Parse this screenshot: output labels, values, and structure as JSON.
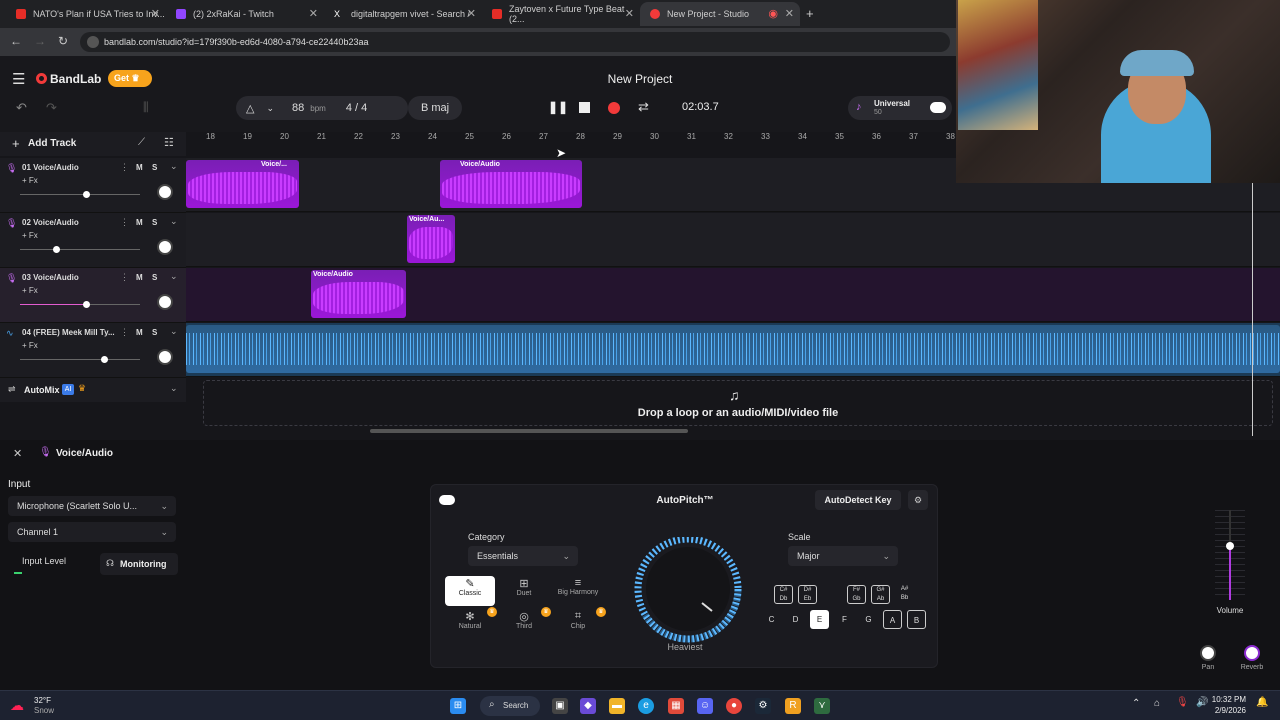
{
  "browser": {
    "tabs": [
      {
        "title": "NATO's Plan if USA Tries to Inv...",
        "color": "#e52d27"
      },
      {
        "title": "(2) 2xRaKai - Twitch",
        "color": "#9146ff"
      },
      {
        "title": "digitaltrapgem vivet - Search /",
        "color": "#ffffff"
      },
      {
        "title": "Zaytoven x Future Type Beat (2...",
        "color": "#e52d27"
      },
      {
        "title": "New Project - Studio",
        "color": "#f23a3a"
      }
    ],
    "url": "bandlab.com/studio?id=179f390b-ed6d-4080-a794-ce22440b23aa"
  },
  "app": {
    "logo": "BandLab",
    "get_label": "Get",
    "project_title": "New Project",
    "bpm": "88",
    "bpm_unit": "bpm",
    "time_signature": "4 / 4",
    "key": "B maj",
    "time": "02:03.7",
    "instrument_name": "Universal",
    "instrument_sub": "50",
    "add_track": "Add Track"
  },
  "ruler": [
    "18",
    "19",
    "20",
    "21",
    "22",
    "23",
    "24",
    "25",
    "26",
    "27",
    "28",
    "29",
    "30",
    "31",
    "32",
    "33",
    "34",
    "35",
    "36",
    "37",
    "38"
  ],
  "tracks": [
    {
      "name": "01 Voice/Audio",
      "fx": "+ Fx",
      "mute": "M",
      "solo": "S",
      "volume": 0.55
    },
    {
      "name": "02 Voice/Audio",
      "fx": "+ Fx",
      "mute": "M",
      "solo": "S",
      "volume": 0.3
    },
    {
      "name": "03 Voice/Audio",
      "fx": "+ Fx",
      "mute": "M",
      "solo": "S",
      "volume": 0.55
    },
    {
      "name": "04 (FREE) Meek Mill Ty...",
      "fx": "+ Fx",
      "mute": "M",
      "solo": "S",
      "volume": 0.7
    }
  ],
  "clips": [
    {
      "track": 0,
      "label": "Voice/..."
    },
    {
      "track": 0,
      "label": "Voice/Audio"
    },
    {
      "track": 1,
      "label": "Voice/Au..."
    },
    {
      "track": 2,
      "label": "Voice/Audio"
    }
  ],
  "automix": {
    "label": "AutoMix",
    "badge": "AI"
  },
  "drop_zone": "Drop a loop or an audio/MIDI/video file",
  "panel": {
    "title": "Voice/Audio",
    "input_label": "Input",
    "input_device": "Microphone (Scarlett Solo U...",
    "channel": "Channel 1",
    "input_level": "Input Level",
    "monitoring": "Monitoring",
    "effect_name": "AutoPitch™",
    "autodetect": "AutoDetect Key",
    "category_label": "Category",
    "category_value": "Essentials",
    "styles": [
      "Classic",
      "Duet",
      "Big Harmony",
      "Natural",
      "Third",
      "Chip"
    ],
    "knob_label": "Heaviest",
    "scale_label": "Scale",
    "scale_value": "Major",
    "sharp_keys": [
      "C#\nDb",
      "D#\nEb",
      "F#\nGb",
      "G#\nAb",
      "A#\nBb"
    ],
    "keys": [
      "C",
      "D",
      "E",
      "F",
      "G",
      "A",
      "B"
    ],
    "volume_label": "Volume",
    "volume_level": 0.6,
    "pan_label": "Pan",
    "reverb_label": "Reverb"
  },
  "taskbar": {
    "weather_temp": "32°F",
    "weather_desc": "Snow",
    "search_label": "Search",
    "time": "10:32 PM",
    "date": "2/9/2026"
  }
}
